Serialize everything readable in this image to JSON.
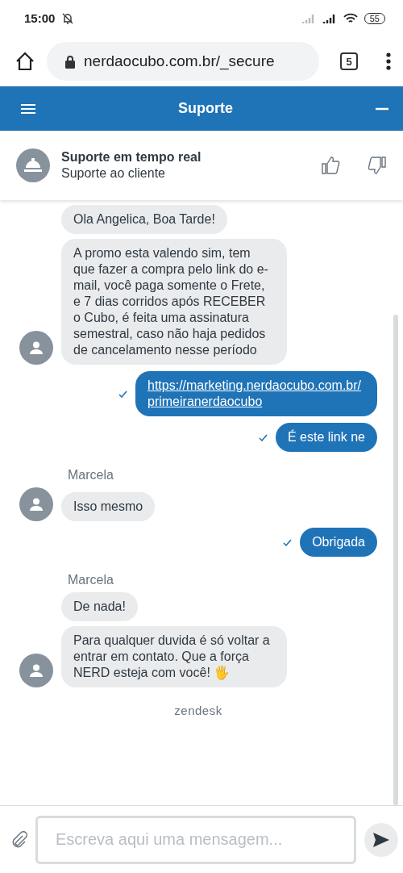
{
  "status_bar": {
    "time": "15:00",
    "battery": "55"
  },
  "browser": {
    "url": "nerdaocubo.com.br/_secure",
    "tab_count": "5"
  },
  "widget_header": {
    "title": "Suporte"
  },
  "agent_bar": {
    "title": "Suporte em tempo real",
    "subtitle": "Suporte ao cliente"
  },
  "thread": [
    {
      "kind": "agent",
      "messages": [
        "Ola Angelica, Boa Tarde!",
        "A promo esta valendo sim, tem que fazer a compra pelo link do e-mail, você paga somente o Frete, e 7 dias corridos após RECEBER o Cubo, é feita uma assinatura semestral, caso não haja pedidos de cancelamento nesse período"
      ]
    },
    {
      "kind": "visitor",
      "text": "https://marketing.nerdaocubo.com.br/primeiranerdaocubo",
      "link": true,
      "delivered": true
    },
    {
      "kind": "visitor",
      "text": "É este link ne",
      "link": false,
      "delivered": true
    },
    {
      "kind": "agent",
      "name": "Marcela",
      "messages": [
        "Isso mesmo"
      ]
    },
    {
      "kind": "visitor",
      "text": "Obrigada",
      "link": false,
      "delivered": true
    },
    {
      "kind": "agent",
      "name": "Marcela",
      "messages": [
        "De nada!",
        "Para qualquer duvida é só voltar a entrar em contato. Que a força NERD esteja com você! 🖐"
      ]
    }
  ],
  "branding": "zendesk",
  "composer": {
    "placeholder": "Escreva aqui uma mensagem..."
  }
}
